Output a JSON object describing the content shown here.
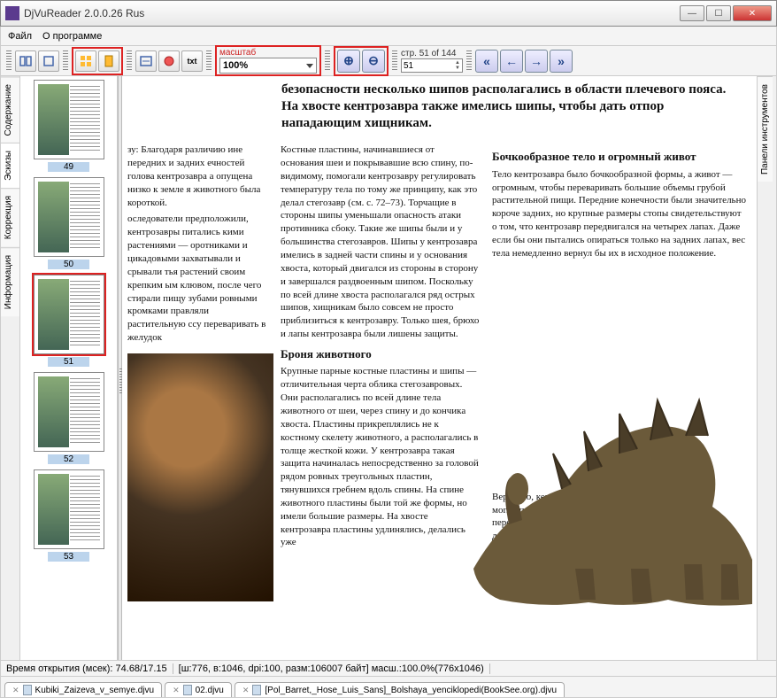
{
  "window": {
    "title": "DjVuReader 2.0.0.26 Rus"
  },
  "menu": {
    "file": "Файл",
    "about": "О программе"
  },
  "toolbar": {
    "zoom_label": "масштаб",
    "zoom_value": "100%",
    "page_label": "стр. 51 of 144",
    "page_value": "51",
    "txt": "txt"
  },
  "left_tabs": {
    "contents": "Содержание",
    "thumbs": "Эскизы",
    "correction": "Коррекция",
    "info": "Информация"
  },
  "right_tabs": {
    "panels": "Панели инструментов"
  },
  "thumbs": [
    {
      "num": "49"
    },
    {
      "num": "50"
    },
    {
      "num": "51",
      "selected": true
    },
    {
      "num": "52"
    },
    {
      "num": "53"
    }
  ],
  "doc": {
    "lead": "безопасности несколько шипов располагались в области плечевого пояса. На хвосте кентрозавра также имелись шипы, чтобы дать отпор нападающим хищникам.",
    "colL_intro": "зу: Благодаря различию ине передних и задних ечностей голова кентрозавра а опущена низко к земле я животного была короткой.",
    "colL_body": "оследователи предположили, кентрозавры питались кими растениями — оротниками и цикадовыми захватывали и срывали тья растений своим крепким ым клювом, после чего стирали пищу зубами ровными кромками правляли растительную ссу переваривать в желудок",
    "colM_p1": "Костные пластины, начинавшиеся от основания шеи и покрывавшие всю спину, по-видимому, помогали кентрозавру регулировать температуру тела по тому же принципу, как это делал стегозавр (см. с. 72–73). Торчащие в стороны шипы уменьшали опасность атаки противника сбоку. Такие же шипы были и у большинства стегозавров. Шипы у кентрозавра имелись в задней части спины и у основания хвоста, который двигался из стороны в сторону и завершался раздвоенным шипом. Поскольку по всей длине хвоста располагался ряд острых шипов, хищникам было совсем не просто приблизиться к кентрозавру. Только шея, брюхо и лапы кентрозавра были лишены защиты.",
    "colM_h2": "Броня животного",
    "colM_p2": "Крупные парные костные пластины и шипы — отличительная черта облика стегозавровых. Они располагались по всей длине тела животного от шеи, через спину и до кончика хвоста. Пластины прикреплялись не к костному скелету животного, а располагались в толще жесткой кожи. У кентрозавра такая защита начиналась непосредственно за головой рядом ровных треугольных пластин, тянувшихся гребнем вдоль спины. На спине животного пластины были той же формы, но имели большие размеры. На хвосте кентрозавра пластины удлинялись, делались уже",
    "colR_h1": "Бочкообразное тело и огромный живот",
    "colR_p1": "Тело кентрозавра было бочкообразной формы, а живот — огромным, чтобы переваривать большие объемы грубой растительной пищи. Передние конечности были значительно короче задних, но крупные размеры стопы свидетельствуют о том, что кентрозавр передвигался на четырех лапах. Даже если бы они пытались опираться только на задних лапах, вес тела немедленно вернул бы их в исходное положение.",
    "colR_p2": "Вероятно, кентрозавры могли порой опираться передними конечностями о деревья, чтобы достать молодые побеги,"
  },
  "status": {
    "time": "Время открытия (мсек): 74.68/17.15",
    "info": "[ш:776, в:1046, dpi:100, разм:106007 байт] масш.:100.0%(776x1046)"
  },
  "files": {
    "f1": "Kubiki_Zaizeva_v_semye.djvu",
    "f2": "02.djvu",
    "f3": "[Pol_Barret,_Hose_Luis_Sans]_Bolshaya_yenciklopedi(BookSee.org).djvu"
  }
}
